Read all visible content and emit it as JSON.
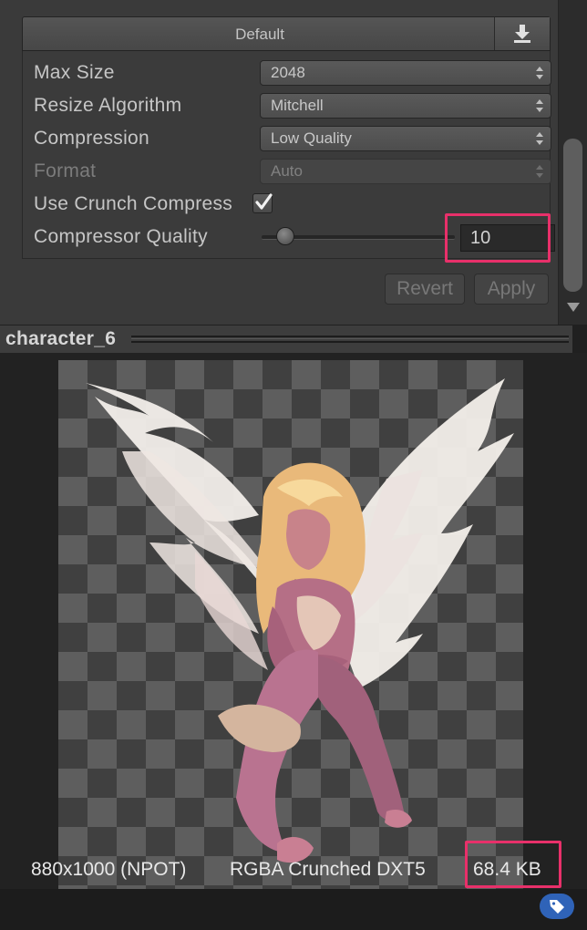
{
  "platform": {
    "tab_label": "Default",
    "download_icon": "download-icon"
  },
  "settings": {
    "max_size": {
      "label": "Max Size",
      "value": "2048"
    },
    "resize_algorithm": {
      "label": "Resize Algorithm",
      "value": "Mitchell"
    },
    "compression": {
      "label": "Compression",
      "value": "Low Quality"
    },
    "format": {
      "label": "Format",
      "value": "Auto"
    },
    "use_crunch": {
      "label": "Use Crunch Compress",
      "checked": true
    },
    "compressor_quality": {
      "label": "Compressor Quality",
      "value": "10",
      "slider_fraction": 0.1
    }
  },
  "buttons": {
    "revert": "Revert",
    "apply": "Apply"
  },
  "preview": {
    "title": "character_6",
    "dimensions": "880x1000 (NPOT)",
    "format": "RGBA Crunched DXT5",
    "size": "68.4 KB",
    "label_icon": "tag-icon"
  },
  "colors": {
    "highlight": "#e8306a",
    "panel": "#3a3a3a",
    "tag": "#2f63b8"
  }
}
